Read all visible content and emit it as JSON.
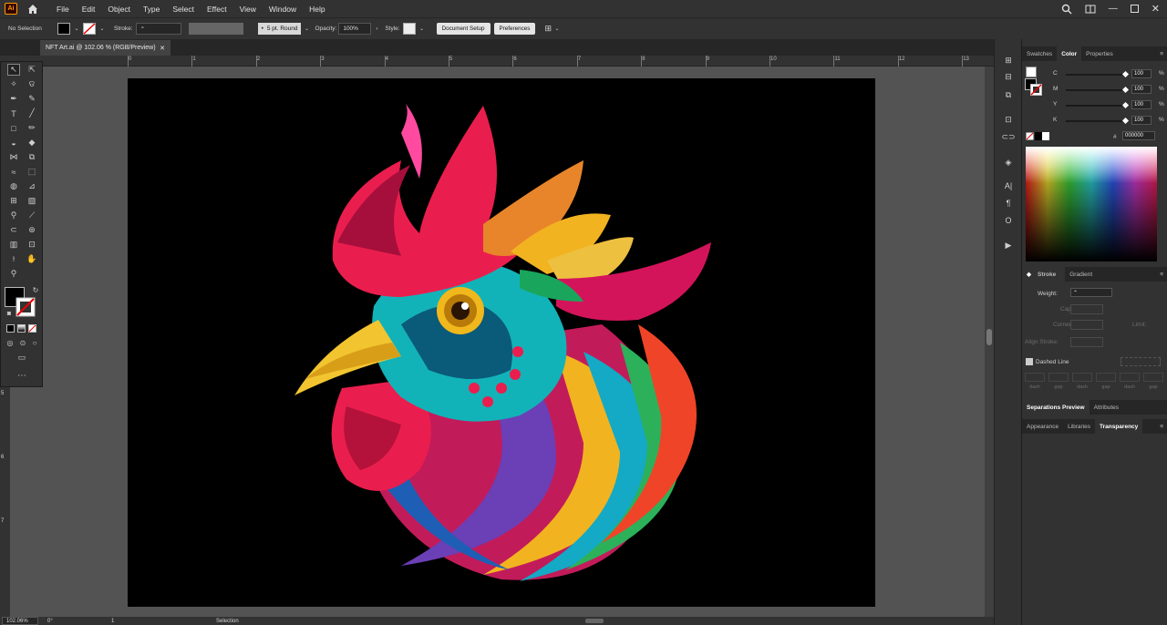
{
  "app": {
    "logo": "Ai"
  },
  "menu": [
    "File",
    "Edit",
    "Object",
    "Type",
    "Select",
    "Effect",
    "View",
    "Window",
    "Help"
  ],
  "control": {
    "selection": "No Selection",
    "stroke_label": "Stroke:",
    "brush": "5 pt. Round",
    "opacity_label": "Opacity:",
    "opacity": "100%",
    "style_label": "Style:",
    "doc_setup": "Document Setup",
    "preferences": "Preferences"
  },
  "document": {
    "tab": "NFT Art.ai @ 102.06 % (RGB/Preview)"
  },
  "ruler": {
    "h_ticks": [
      "0",
      "1",
      "2",
      "3",
      "4",
      "5",
      "6",
      "7",
      "8",
      "9",
      "10",
      "11",
      "12",
      "13"
    ],
    "v_ticks": [
      "5",
      "6",
      "7"
    ]
  },
  "status": {
    "zoom": "102.06%",
    "rotation": "0°",
    "artboard": "1",
    "tool": "Selection"
  },
  "panels": {
    "top_tabs": [
      "Swatches",
      "Color",
      "Properties"
    ],
    "active_top": "Color",
    "cmyk": [
      {
        "l": "C",
        "v": "100"
      },
      {
        "l": "M",
        "v": "100"
      },
      {
        "l": "Y",
        "v": "100"
      },
      {
        "l": "K",
        "v": "100"
      }
    ],
    "hex_label": "#",
    "hex": "000000",
    "stroke_tabs": [
      "Stroke",
      "Gradient"
    ],
    "weight_label": "Weight:",
    "cap_label": "Cap:",
    "corner_label": "Corner:",
    "limit_label": "Limit:",
    "align_label": "Align Stroke:",
    "dashed_label": "Dashed Line",
    "dash_labels": [
      "dash",
      "gap",
      "dash",
      "gap",
      "dash",
      "gap"
    ],
    "sep_tabs": [
      "Separations Preview",
      "Attributes"
    ],
    "bottom_tabs": [
      "Appearance",
      "Libraries",
      "Transparency"
    ]
  },
  "colors": {
    "accent": "#ff9a00",
    "artboard": "#000000",
    "workspace": "#535353"
  }
}
